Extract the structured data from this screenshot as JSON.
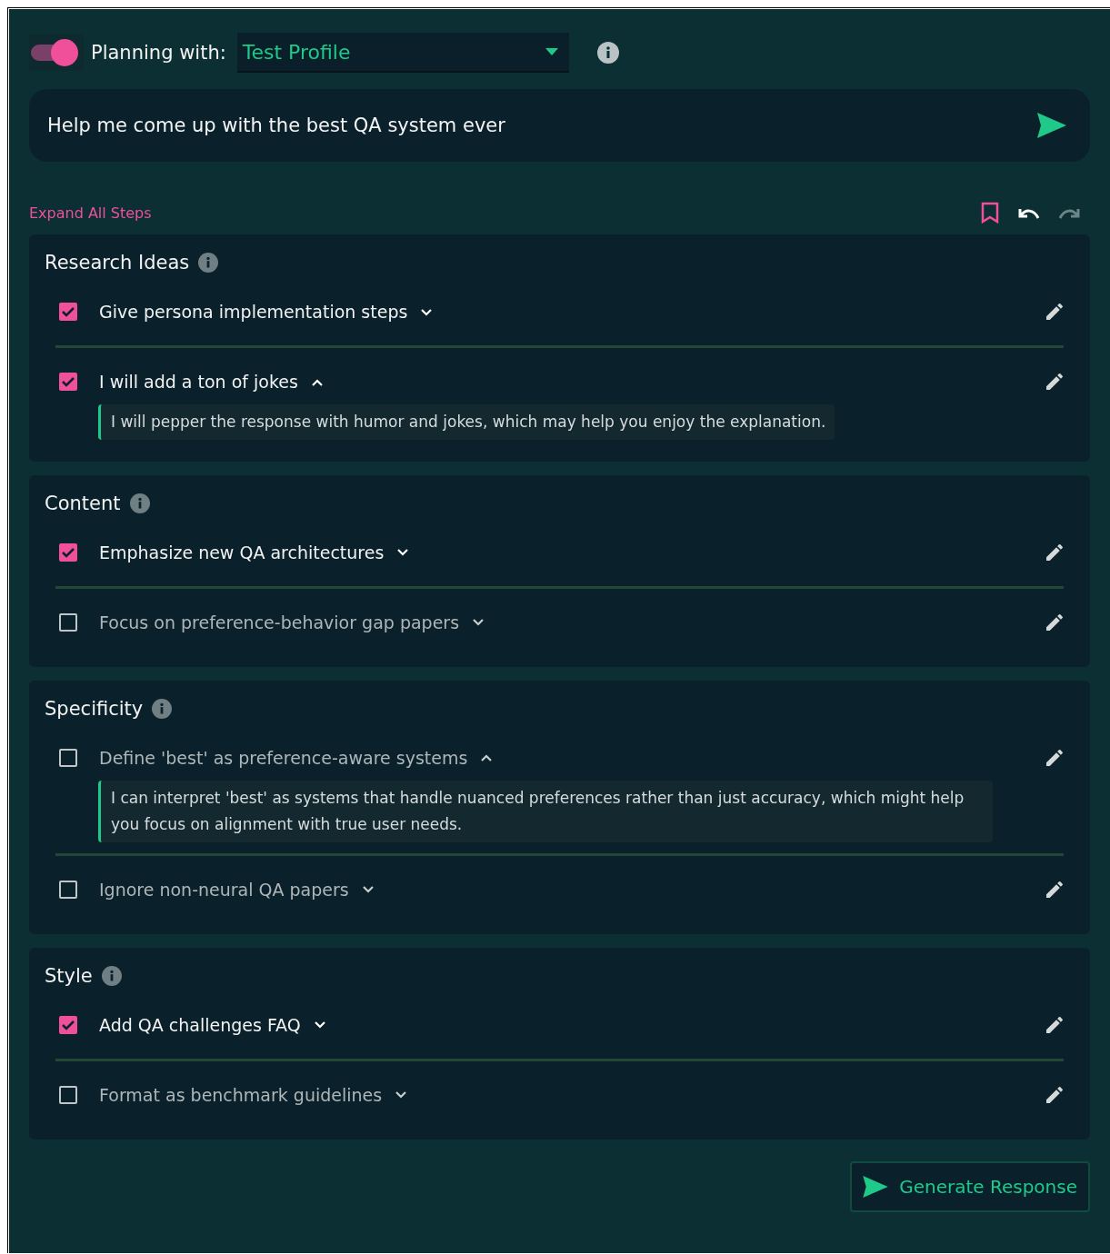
{
  "planning": {
    "on": true,
    "label": "Planning with:",
    "profile": "Test Profile"
  },
  "prompt": {
    "value": "Help me come up with the best QA system ever"
  },
  "toolbar": {
    "expand_all": "Expand All Steps",
    "undo_disabled": false,
    "redo_disabled": true
  },
  "sections": [
    {
      "title": "Research Ideas",
      "steps": [
        {
          "label": "Give persona implementation steps",
          "checked": true,
          "expanded": false
        },
        {
          "label": "I will add a ton of jokes",
          "checked": true,
          "expanded": true,
          "detail": "I will pepper the response with humor and jokes, which may help you enjoy the explanation."
        }
      ]
    },
    {
      "title": "Content",
      "steps": [
        {
          "label": "Emphasize new QA architectures",
          "checked": true,
          "expanded": false
        },
        {
          "label": "Focus on preference-behavior gap papers",
          "checked": false,
          "expanded": false
        }
      ]
    },
    {
      "title": "Specificity",
      "steps": [
        {
          "label": "Define 'best' as preference-aware systems",
          "checked": false,
          "expanded": true,
          "detail": "I can interpret 'best' as systems that handle nuanced preferences rather than just accuracy, which might help you focus on alignment with true user needs."
        },
        {
          "label": "Ignore non-neural QA papers",
          "checked": false,
          "expanded": false
        }
      ]
    },
    {
      "title": "Style",
      "steps": [
        {
          "label": "Add QA challenges FAQ",
          "checked": true,
          "expanded": false
        },
        {
          "label": "Format as benchmark guidelines",
          "checked": false,
          "expanded": false
        }
      ]
    }
  ],
  "generate_button": "Generate Response"
}
